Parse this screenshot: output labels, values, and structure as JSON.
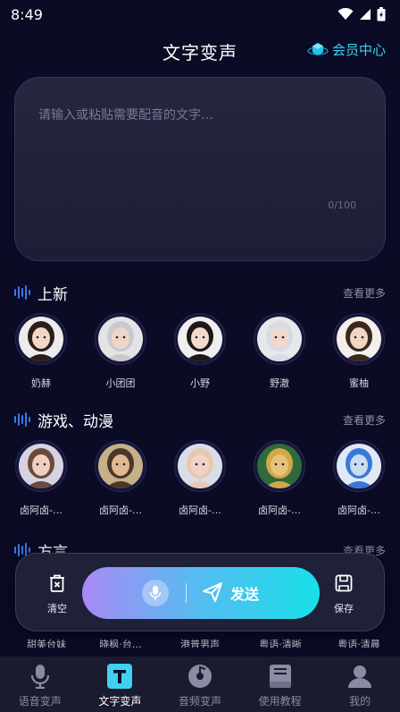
{
  "status": {
    "time": "8:49"
  },
  "header": {
    "title": "文字变声",
    "vip_label": "会员中心"
  },
  "editor": {
    "placeholder": "请输入或粘贴需要配音的文字…",
    "count": "0/100"
  },
  "sections": [
    {
      "title": "上新",
      "more": "查看更多",
      "voices": [
        {
          "name": "奶赫",
          "skin": "#f1d7c8",
          "hair": "#2a1d1a",
          "bg": "#ececec"
        },
        {
          "name": "小团团",
          "skin": "#efd5c7",
          "hair": "#c9c9cf",
          "bg": "#e4e4e6"
        },
        {
          "name": "小野",
          "skin": "#f3dacd",
          "hair": "#1c1818",
          "bg": "#efefef"
        },
        {
          "name": "野澈",
          "skin": "#f0d8cc",
          "hair": "#d8dbe4",
          "bg": "#e6e8ec"
        },
        {
          "name": "蜜柚",
          "skin": "#f2d6c4",
          "hair": "#3a2720",
          "bg": "#f4efe9"
        }
      ]
    },
    {
      "title": "游戏、动漫",
      "more": "查看更多",
      "voices": [
        {
          "name": "卤阿卤-…",
          "skin": "#f0cfc0",
          "hair": "#6a4a3a",
          "bg": "#d6d2e0"
        },
        {
          "name": "卤阿卤-…",
          "skin": "#e2b890",
          "hair": "#4a3826",
          "bg": "#c5b08a"
        },
        {
          "name": "卤阿卤-…",
          "skin": "#f2d2c6",
          "hair": "#e8c9b0",
          "bg": "#d8dde8"
        },
        {
          "name": "卤阿卤-…",
          "skin": "#e8c278",
          "hair": "#d4a64a",
          "bg": "#2f6a3a"
        },
        {
          "name": "卤阿卤-…",
          "skin": "#c8dcf2",
          "hair": "#3a78d8",
          "bg": "#dfe8f4"
        }
      ]
    },
    {
      "title": "方言",
      "more": "查看更多"
    }
  ],
  "peek_names": [
    "甜美台妹",
    "晓枫·台…",
    "港普男声",
    "粤语·清晰",
    "粤语·清晨"
  ],
  "actions": {
    "clear": "清空",
    "send": "发送",
    "save": "保存"
  },
  "tabs": [
    {
      "label": "语音变声",
      "icon": "microphone-icon"
    },
    {
      "label": "文字变声",
      "icon": "text-icon",
      "active": true
    },
    {
      "label": "音频变声",
      "icon": "audio-disc-icon"
    },
    {
      "label": "使用教程",
      "icon": "book-icon"
    },
    {
      "label": "我的",
      "icon": "person-icon"
    }
  ],
  "colors": {
    "background": "#0b0b26",
    "accent": "#39d4f0",
    "wave": "#3a78e8"
  }
}
